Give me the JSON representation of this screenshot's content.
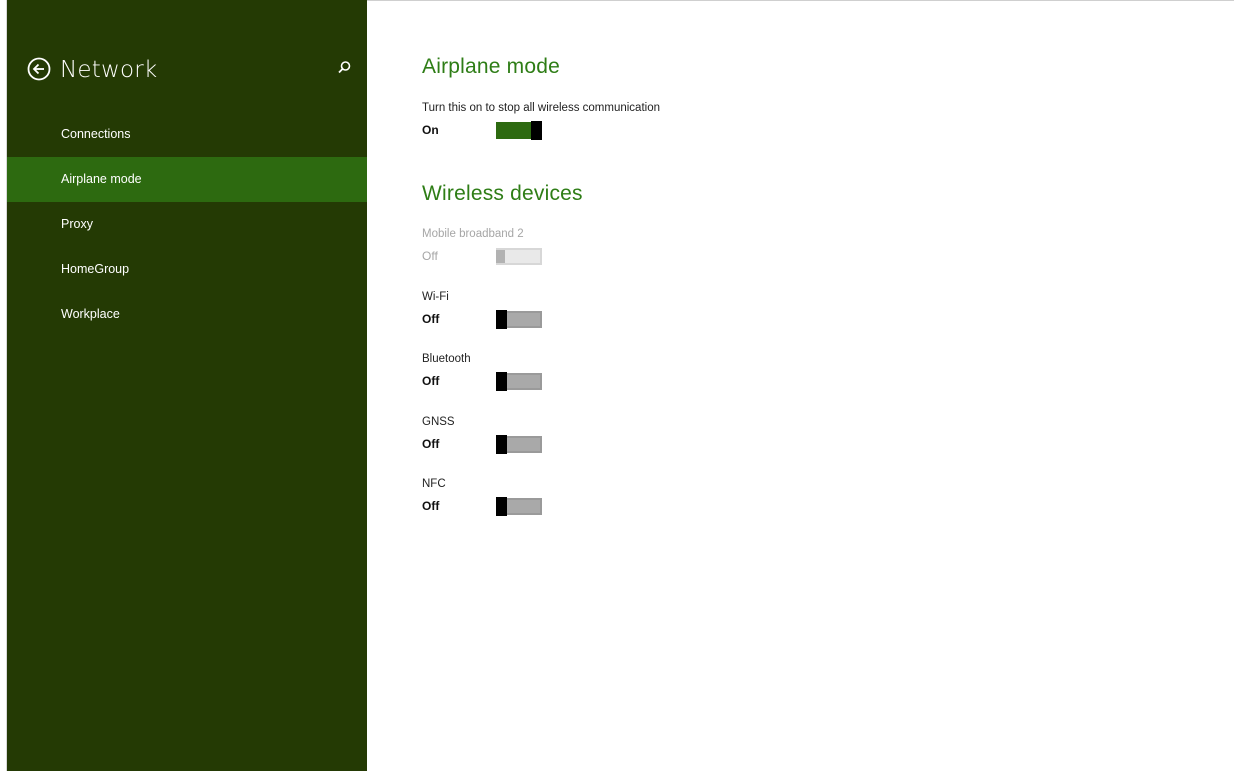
{
  "sidebar": {
    "title": "Network",
    "items": [
      {
        "label": "Connections"
      },
      {
        "label": "Airplane mode"
      },
      {
        "label": "Proxy"
      },
      {
        "label": "HomeGroup"
      },
      {
        "label": "Workplace"
      }
    ],
    "selected_index": 1,
    "back_icon": "back-arrow-circle-icon",
    "search_icon": "search-icon"
  },
  "airplane": {
    "title": "Airplane mode",
    "description": "Turn this on to stop all wireless communication",
    "state": "On",
    "toggle_on": true
  },
  "wireless": {
    "title": "Wireless devices",
    "devices": [
      {
        "label": "Mobile broadband 2",
        "state": "Off",
        "enabled": false
      },
      {
        "label": "Wi-Fi",
        "state": "Off",
        "enabled": true
      },
      {
        "label": "Bluetooth",
        "state": "Off",
        "enabled": true
      },
      {
        "label": "GNSS",
        "state": "Off",
        "enabled": true
      },
      {
        "label": "NFC",
        "state": "Off",
        "enabled": true
      }
    ]
  },
  "colors": {
    "sidebar_bg": "#243a04",
    "sidebar_selected": "#2d6a10",
    "accent": "#2e7d16",
    "toggle_off": "#a9a9a9",
    "toggle_disabled": "#e9e9e9"
  }
}
